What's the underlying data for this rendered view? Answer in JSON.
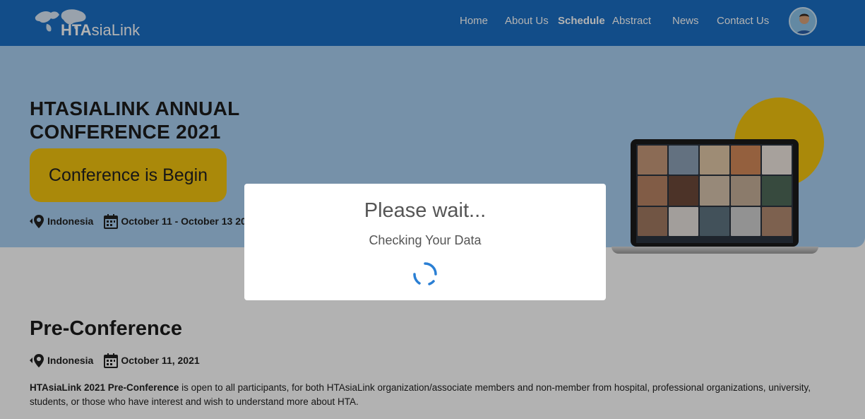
{
  "nav": {
    "logo_prefix": "HTA",
    "logo_suffix": "siaLink",
    "items": [
      {
        "label": "Home",
        "active": false
      },
      {
        "label": "About Us",
        "active": false
      },
      {
        "label": "Schedule",
        "active": true
      },
      {
        "label": "Abstract",
        "active": false
      },
      {
        "label": "News",
        "active": false
      },
      {
        "label": "Contact Us",
        "active": false
      }
    ],
    "avatar_icon": "user-avatar"
  },
  "hero": {
    "title": "HTASIALINK ANNUAL CONFERENCE 2021",
    "cta_label": "Conference is Begin",
    "location": "Indonesia",
    "dates": "October 11 - October 13 2021"
  },
  "pre_conference": {
    "title": "Pre-Conference",
    "location": "Indonesia",
    "date": "October 11, 2021",
    "description_bold": "HTAsiaLink 2021 Pre-Conference",
    "description_rest": " is open to all participants, for both HTAsiaLink organization/associate members and non-member from hospital, professional organizations, university, students, or those who have interest and wish to understand more about HTA."
  },
  "modal": {
    "title": "Please wait...",
    "subtitle": "Checking Your Data"
  },
  "colors": {
    "navbar": "#1a6fc4",
    "hero_bg": "#a9d0f2",
    "accent_yellow": "#f4c40f",
    "spinner": "#2a7fd4"
  },
  "icons": {
    "location": "location-pin-icon",
    "calendar": "calendar-icon",
    "spinner": "loading-spinner-icon"
  }
}
